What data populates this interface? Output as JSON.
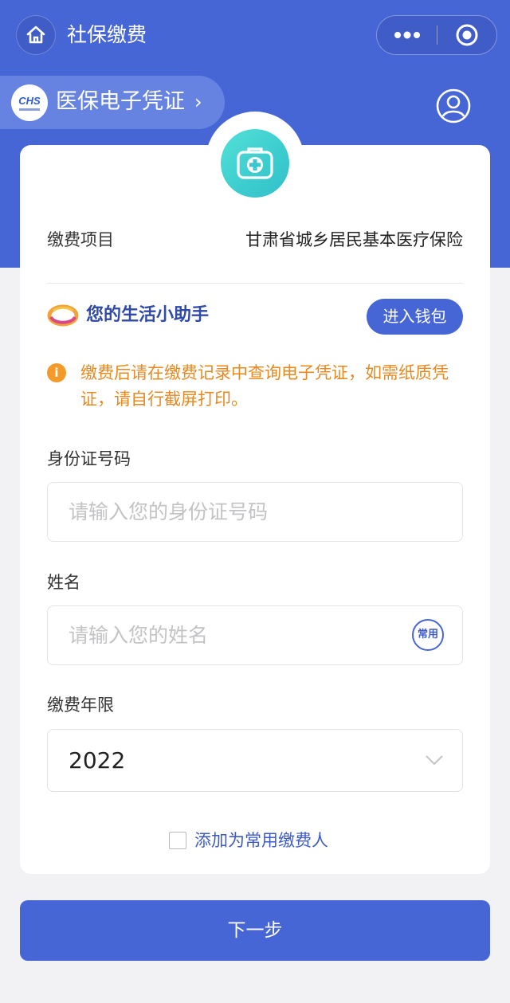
{
  "header": {
    "title": "社保缴费",
    "home_icon": "home-icon",
    "more_icon": "more-dots-icon",
    "close_icon": "target-close-icon"
  },
  "credential": {
    "logo_text": "CHS",
    "label": "医保电子凭证",
    "arrow": "›"
  },
  "user_icon": "user-profile-icon",
  "card": {
    "kit_icon": "medical-kit-icon",
    "item_label": "缴费项目",
    "item_value": "甘肃省城乡居民基本医疗保险",
    "helper_text": "您的生活小助手",
    "wallet_button": "进入钱包",
    "notice_icon": "i",
    "notice_text": "缴费后请在缴费记录中查询电子凭证，如需纸质凭证，请自行截屏打印。",
    "id_label": "身份证号码",
    "id_placeholder": "请输入您的身份证号码",
    "name_label": "姓名",
    "name_placeholder": "请输入您的姓名",
    "common_badge": "常用",
    "year_label": "缴费年限",
    "year_value": "2022",
    "add_common_label": "添加为常用缴费人"
  },
  "next_button": "下一步",
  "colors": {
    "primary": "#4766d6",
    "notice": "#e8891f",
    "teal": "#3cc9cf",
    "background": "#f2f2f4"
  }
}
